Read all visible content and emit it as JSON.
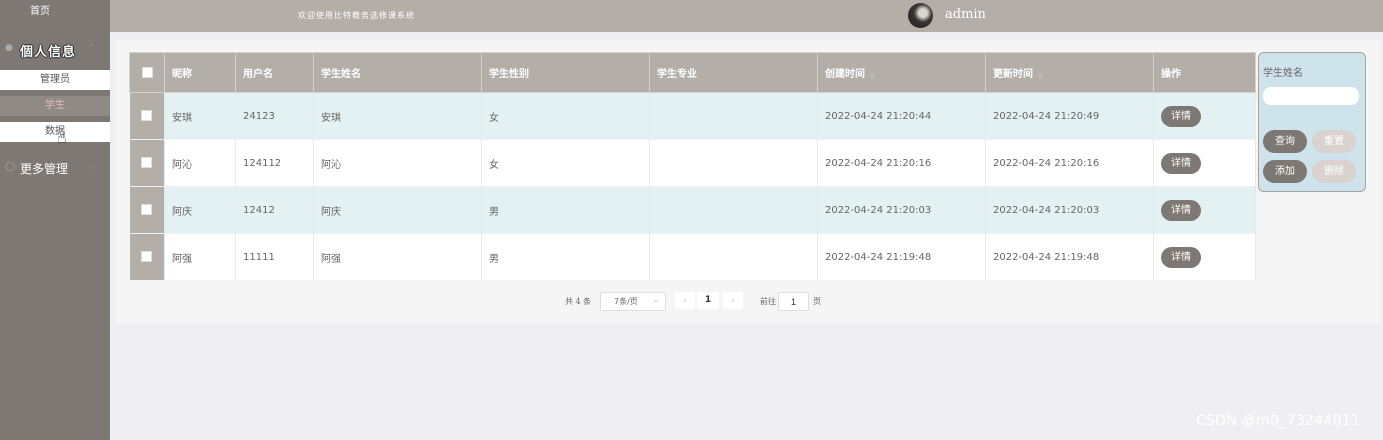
{
  "sidebar": {
    "home": "首页",
    "group1": {
      "label": "個人信息",
      "icon": "user-icon"
    },
    "sub_items": [
      "管理员",
      "学生",
      "数据"
    ],
    "group2": {
      "label": "更多管理",
      "icon": "chat-bubble-icon"
    }
  },
  "header": {
    "welcome": "欢迎使用比特教务选修课系统",
    "username": "admin",
    "avatar_icon": "avatar-photo"
  },
  "table": {
    "columns": [
      "昵称",
      "用户名",
      "学生姓名",
      "学生性别",
      "学生专业",
      "创建时间",
      "更新时间",
      "操作"
    ],
    "sort_icon": "◇",
    "detail_label": "详情",
    "rows": [
      {
        "nickname": "安琪",
        "username": "24123",
        "name": "安琪",
        "gender": "女",
        "major": "",
        "created": "2022-04-24 21:20:44",
        "updated": "2022-04-24 21:20:49"
      },
      {
        "nickname": "阿沁",
        "username": "124112",
        "name": "阿沁",
        "gender": "女",
        "major": "",
        "created": "2022-04-24 21:20:16",
        "updated": "2022-04-24 21:20:16"
      },
      {
        "nickname": "阿庆",
        "username": "12412",
        "name": "阿庆",
        "gender": "男",
        "major": "",
        "created": "2022-04-24 21:20:03",
        "updated": "2022-04-24 21:20:03"
      },
      {
        "nickname": "阿强",
        "username": "11111",
        "name": "阿强",
        "gender": "男",
        "major": "",
        "created": "2022-04-24 21:19:48",
        "updated": "2022-04-24 21:19:48"
      }
    ]
  },
  "search": {
    "label": "学生姓名",
    "query": "查询",
    "reset": "重置",
    "add": "添加",
    "delete": "删除"
  },
  "pagination": {
    "total": "共 4 条",
    "page_size": "7条/页",
    "current_page": "1",
    "goto": "前往",
    "jump_value": "1",
    "page_suffix": "页"
  },
  "watermark": "CSDN @m0_73244011",
  "colors": {
    "sidebar": "#7d7874",
    "header": "#b4aea8",
    "accent": "#e9b9b4",
    "row_alt": "#e4f1f3"
  }
}
